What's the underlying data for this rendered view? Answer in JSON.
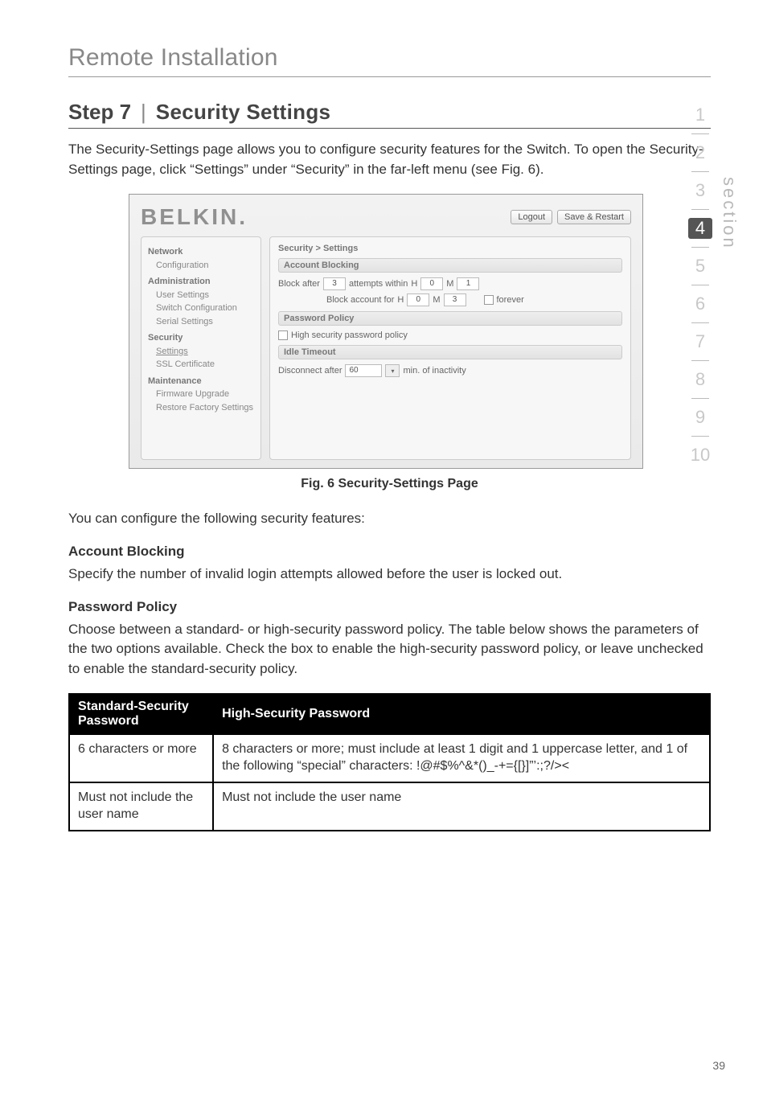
{
  "header": {
    "title": "Remote Installation"
  },
  "step": {
    "label": "Step 7",
    "separator": "|",
    "title": "Security Settings"
  },
  "intro": "The Security-Settings page allows you to configure security features for the Switch. To open the Security-Settings page, click “Settings” under “Security” in the far-left menu (see Fig. 6).",
  "rail": {
    "items": [
      "1",
      "2",
      "3",
      "4",
      "5",
      "6",
      "7",
      "8",
      "9",
      "10"
    ],
    "active_index": 3,
    "label": "section"
  },
  "screenshot": {
    "logo": "BELKIN.",
    "buttons": {
      "logout": "Logout",
      "save_restart": "Save & Restart"
    },
    "nav": {
      "groups": [
        {
          "title": "Network",
          "items": [
            "Configuration"
          ]
        },
        {
          "title": "Administration",
          "items": [
            "User Settings",
            "Switch Configuration",
            "Serial Settings"
          ]
        },
        {
          "title": "Security",
          "items": [
            "Settings",
            "SSL Certificate"
          ],
          "active": "Settings"
        },
        {
          "title": "Maintenance",
          "items": [
            "Firmware Upgrade",
            "Restore Factory Settings"
          ]
        }
      ]
    },
    "content": {
      "breadcrumb": "Security > Settings",
      "account_blocking": {
        "heading": "Account Blocking",
        "block_after_label": "Block after",
        "block_after_value": "3",
        "attempts_within_label": "attempts within",
        "h1_label": "H",
        "h1_value": "0",
        "m1_label": "M",
        "m1_value": "1",
        "block_account_for_label": "Block account for",
        "h2_label": "H",
        "h2_value": "0",
        "m2_label": "M",
        "m2_value": "3",
        "forever_label": "forever"
      },
      "password_policy": {
        "heading": "Password Policy",
        "checkbox_label": "High security password policy"
      },
      "idle_timeout": {
        "heading": "Idle Timeout",
        "disconnect_label": "Disconnect after",
        "disconnect_value": "60",
        "unit_label": "min. of inactivity"
      }
    }
  },
  "fig_caption": "Fig. 6 Security-Settings Page",
  "after_fig": "You can configure the following security features:",
  "account_blocking": {
    "heading": "Account Blocking",
    "text": "Specify the number of invalid login attempts allowed before the user is locked out."
  },
  "password_policy": {
    "heading": "Password Policy",
    "text": "Choose between a standard- or high-security password policy. The table below shows the parameters of the two options available. Check the box to enable the high-security password policy, or leave unchecked to enable the standard-security policy."
  },
  "table": {
    "headers": {
      "std": "Standard-Security Password",
      "high": "High-Security Password"
    },
    "rows": [
      {
        "std": "6 characters or more",
        "high": "8 characters or more; must include at least 1 digit and 1 uppercase letter, and 1 of the following “special” characters: !@#$%^&*()_-+={[}]”’:;?/><"
      },
      {
        "std": "Must not include the user name",
        "high": "Must not include the user name"
      }
    ]
  },
  "page_number": "39"
}
